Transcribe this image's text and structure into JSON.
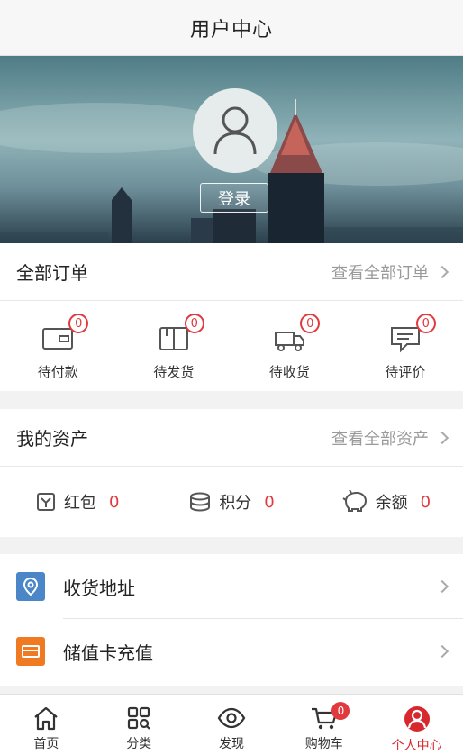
{
  "header": {
    "title": "用户中心"
  },
  "profile": {
    "login_label": "登录",
    "avatar_icon": "user-icon"
  },
  "orders": {
    "title": "全部订单",
    "view_all": "查看全部订单",
    "items": [
      {
        "label": "待付款",
        "count": "0",
        "icon": "wallet-icon"
      },
      {
        "label": "待发货",
        "count": "0",
        "icon": "package-icon"
      },
      {
        "label": "待收货",
        "count": "0",
        "icon": "truck-icon"
      },
      {
        "label": "待评价",
        "count": "0",
        "icon": "comment-icon"
      }
    ]
  },
  "assets": {
    "title": "我的资产",
    "view_all": "查看全部资产",
    "items": [
      {
        "label": "红包",
        "value": "0",
        "icon": "red-packet-icon"
      },
      {
        "label": "积分",
        "value": "0",
        "icon": "coins-icon"
      },
      {
        "label": "余额",
        "value": "0",
        "icon": "piggy-bank-icon"
      }
    ]
  },
  "menu": [
    {
      "label": "收货地址",
      "icon": "location-pin-icon",
      "color": "#4a86c8"
    },
    {
      "label": "储值卡充值",
      "icon": "card-icon",
      "color": "#f07a22"
    }
  ],
  "tabbar": {
    "items": [
      {
        "label": "首页",
        "icon": "home-icon"
      },
      {
        "label": "分类",
        "icon": "category-icon"
      },
      {
        "label": "发现",
        "icon": "eye-icon"
      },
      {
        "label": "购物车",
        "icon": "cart-icon",
        "badge": "0"
      },
      {
        "label": "个人中心",
        "icon": "person-icon",
        "active": true
      }
    ]
  },
  "colors": {
    "accent": "#e0393e",
    "active_tab": "#d7282e"
  }
}
